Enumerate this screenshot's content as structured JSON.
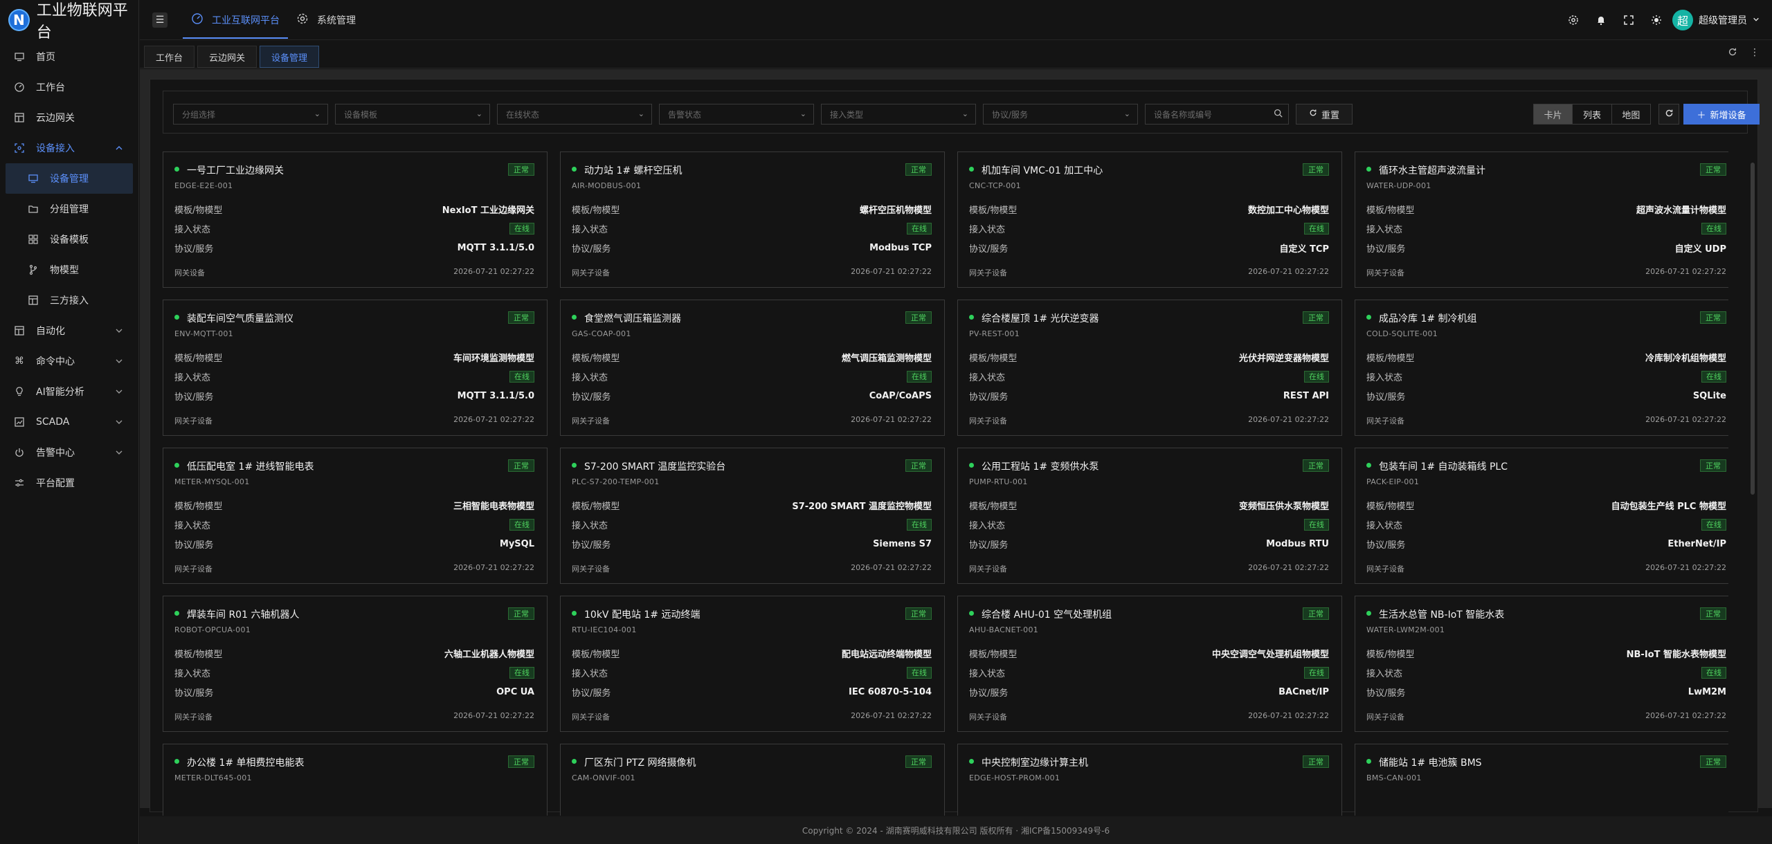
{
  "app": {
    "title": "工业物联网平台",
    "logo_letter": "N"
  },
  "sidebar": {
    "items": [
      {
        "label": "首页"
      },
      {
        "label": "工作台"
      },
      {
        "label": "云边网关"
      },
      {
        "label": "设备接入"
      },
      {
        "label": "自动化"
      },
      {
        "label": "命令中心"
      },
      {
        "label": "AI智能分析"
      },
      {
        "label": "SCADA"
      },
      {
        "label": "告警中心"
      },
      {
        "label": "平台配置"
      }
    ],
    "submenu": [
      {
        "label": "设备管理"
      },
      {
        "label": "分组管理"
      },
      {
        "label": "设备模板"
      },
      {
        "label": "物模型"
      },
      {
        "label": "三方接入"
      }
    ]
  },
  "header": {
    "nav": [
      {
        "label": "工业互联网平台"
      },
      {
        "label": "系统管理"
      }
    ],
    "avatar_text": "超",
    "user_name": "超级管理员"
  },
  "tabs": [
    {
      "label": "工作台"
    },
    {
      "label": "云边网关"
    },
    {
      "label": "设备管理"
    }
  ],
  "filters": {
    "group": "分组选择",
    "template": "设备模板",
    "online": "在线状态",
    "alarm": "告警状态",
    "access": "接入类型",
    "protocol": "协议/服务",
    "search_placeholder": "设备名称或编号",
    "reset": "重置",
    "views": [
      "卡片",
      "列表",
      "地图"
    ],
    "add": "新增设备"
  },
  "labels": {
    "model": "模板/物模型",
    "access": "接入状态",
    "protocol": "协议/服务"
  },
  "devices": [
    {
      "name": "一号工厂工业边缘网关",
      "code": "EDGE-E2E-001",
      "status": "正常",
      "model": "NexIoT 工业边缘网关",
      "access": "在线",
      "protocol": "MQTT 3.1.1/5.0",
      "type": "网关设备",
      "time": "2026-07-21 02:27:22"
    },
    {
      "name": "动力站 1# 螺杆空压机",
      "code": "AIR-MODBUS-001",
      "status": "正常",
      "model": "螺杆空压机物模型",
      "access": "在线",
      "protocol": "Modbus TCP",
      "type": "网关子设备",
      "time": "2026-07-21 02:27:22"
    },
    {
      "name": "机加车间 VMC-01 加工中心",
      "code": "CNC-TCP-001",
      "status": "正常",
      "model": "数控加工中心物模型",
      "access": "在线",
      "protocol": "自定义 TCP",
      "type": "网关子设备",
      "time": "2026-07-21 02:27:22"
    },
    {
      "name": "循环水主管超声波流量计",
      "code": "WATER-UDP-001",
      "status": "正常",
      "model": "超声波水流量计物模型",
      "access": "在线",
      "protocol": "自定义 UDP",
      "type": "网关子设备",
      "time": "2026-07-21 02:27:22"
    },
    {
      "name": "装配车间空气质量监测仪",
      "code": "ENV-MQTT-001",
      "status": "正常",
      "model": "车间环境监测物模型",
      "access": "在线",
      "protocol": "MQTT 3.1.1/5.0",
      "type": "网关子设备",
      "time": "2026-07-21 02:27:22"
    },
    {
      "name": "食堂燃气调压箱监测器",
      "code": "GAS-COAP-001",
      "status": "正常",
      "model": "燃气调压箱监测物模型",
      "access": "在线",
      "protocol": "CoAP/CoAPS",
      "type": "网关子设备",
      "time": "2026-07-21 02:27:22"
    },
    {
      "name": "综合楼屋顶 1# 光伏逆变器",
      "code": "PV-REST-001",
      "status": "正常",
      "model": "光伏并网逆变器物模型",
      "access": "在线",
      "protocol": "REST API",
      "type": "网关子设备",
      "time": "2026-07-21 02:27:22"
    },
    {
      "name": "成品冷库 1# 制冷机组",
      "code": "COLD-SQLITE-001",
      "status": "正常",
      "model": "冷库制冷机组物模型",
      "access": "在线",
      "protocol": "SQLite",
      "type": "网关子设备",
      "time": "2026-07-21 02:27:22"
    },
    {
      "name": "低压配电室 1# 进线智能电表",
      "code": "METER-MYSQL-001",
      "status": "正常",
      "model": "三相智能电表物模型",
      "access": "在线",
      "protocol": "MySQL",
      "type": "网关子设备",
      "time": "2026-07-21 02:27:22"
    },
    {
      "name": "S7-200 SMART 温度监控实验台",
      "code": "PLC-S7-200-TEMP-001",
      "status": "正常",
      "model": "S7-200 SMART 温度监控物模型",
      "access": "在线",
      "protocol": "Siemens S7",
      "type": "网关子设备",
      "time": "2026-07-21 02:27:22"
    },
    {
      "name": "公用工程站 1# 变频供水泵",
      "code": "PUMP-RTU-001",
      "status": "正常",
      "model": "变频恒压供水泵物模型",
      "access": "在线",
      "protocol": "Modbus RTU",
      "type": "网关子设备",
      "time": "2026-07-21 02:27:22"
    },
    {
      "name": "包装车间 1# 自动装箱线 PLC",
      "code": "PACK-EIP-001",
      "status": "正常",
      "model": "自动包装生产线 PLC 物模型",
      "access": "在线",
      "protocol": "EtherNet/IP",
      "type": "网关子设备",
      "time": "2026-07-21 02:27:22"
    },
    {
      "name": "焊装车间 R01 六轴机器人",
      "code": "ROBOT-OPCUA-001",
      "status": "正常",
      "model": "六轴工业机器人物模型",
      "access": "在线",
      "protocol": "OPC UA",
      "type": "网关子设备",
      "time": "2026-07-21 02:27:22"
    },
    {
      "name": "10kV 配电站 1# 远动终端",
      "code": "RTU-IEC104-001",
      "status": "正常",
      "model": "配电站远动终端物模型",
      "access": "在线",
      "protocol": "IEC 60870-5-104",
      "type": "网关子设备",
      "time": "2026-07-21 02:27:22"
    },
    {
      "name": "综合楼 AHU-01 空气处理机组",
      "code": "AHU-BACNET-001",
      "status": "正常",
      "model": "中央空调空气处理机组物模型",
      "access": "在线",
      "protocol": "BACnet/IP",
      "type": "网关子设备",
      "time": "2026-07-21 02:27:22"
    },
    {
      "name": "生活水总管 NB-IoT 智能水表",
      "code": "WATER-LWM2M-001",
      "status": "正常",
      "model": "NB-IoT 智能水表物模型",
      "access": "在线",
      "protocol": "LwM2M",
      "type": "网关子设备",
      "time": "2026-07-21 02:27:22"
    },
    {
      "name": "办公楼 1# 单相费控电能表",
      "code": "METER-DLT645-001",
      "status": "正常",
      "model": "",
      "access": "",
      "protocol": "",
      "type": "",
      "time": ""
    },
    {
      "name": "厂区东门 PTZ 网络摄像机",
      "code": "CAM-ONVIF-001",
      "status": "正常",
      "model": "",
      "access": "",
      "protocol": "",
      "type": "",
      "time": ""
    },
    {
      "name": "中央控制室边缘计算主机",
      "code": "EDGE-HOST-PROM-001",
      "status": "正常",
      "model": "",
      "access": "",
      "protocol": "",
      "type": "",
      "time": ""
    },
    {
      "name": "储能站 1# 电池簇 BMS",
      "code": "BMS-CAN-001",
      "status": "正常",
      "model": "",
      "access": "",
      "protocol": "",
      "type": "",
      "time": ""
    }
  ],
  "footer": "Copyright © 2024 - 湖南赛明威科技有限公司 版权所有 · 湘ICP备15009349号-6"
}
